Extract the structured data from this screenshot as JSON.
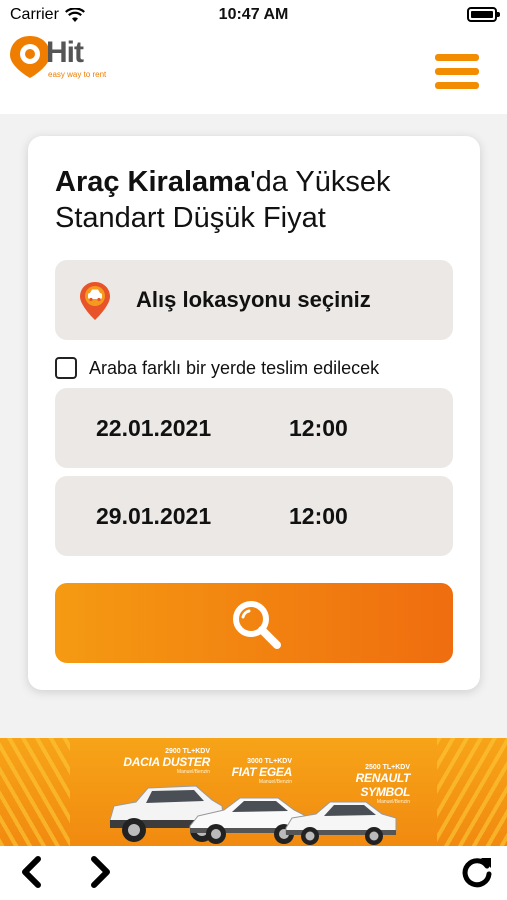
{
  "status_bar": {
    "carrier": "Carrier",
    "time": "10:47 AM"
  },
  "header": {
    "logo_text": "Hit",
    "logo_tagline": "easy way to rent",
    "brand_color": "#f28c00"
  },
  "search_card": {
    "headline_bold": "Araç Kiralama",
    "headline_rest": "'da Yüksek Standart Düşük Fiyat",
    "pickup_location_placeholder": "Alış lokasyonu seçiniz",
    "different_dropoff_label": "Araba farklı bir yerde teslim edilecek",
    "different_dropoff_checked": false,
    "pickup_date": "22.01.2021",
    "pickup_time": "12:00",
    "return_date": "29.01.2021",
    "return_time": "12:00",
    "search_button_icon": "search-icon"
  },
  "banner": {
    "promos": [
      {
        "price": "2900 TL+KDV",
        "model": "DACIA DUSTER",
        "sub": "Manuel/Benzin"
      },
      {
        "price": "3000 TL+KDV",
        "model": "FIAT EGEA",
        "sub": "Manuel/Benzin"
      },
      {
        "price": "2500 TL+KDV",
        "model": "RENAULT SYMBOL",
        "sub": "Manuel/Benzin"
      }
    ]
  },
  "bottom_nav": {
    "back_icon": "chevron-left-icon",
    "forward_icon": "chevron-right-icon",
    "reload_icon": "reload-icon"
  }
}
